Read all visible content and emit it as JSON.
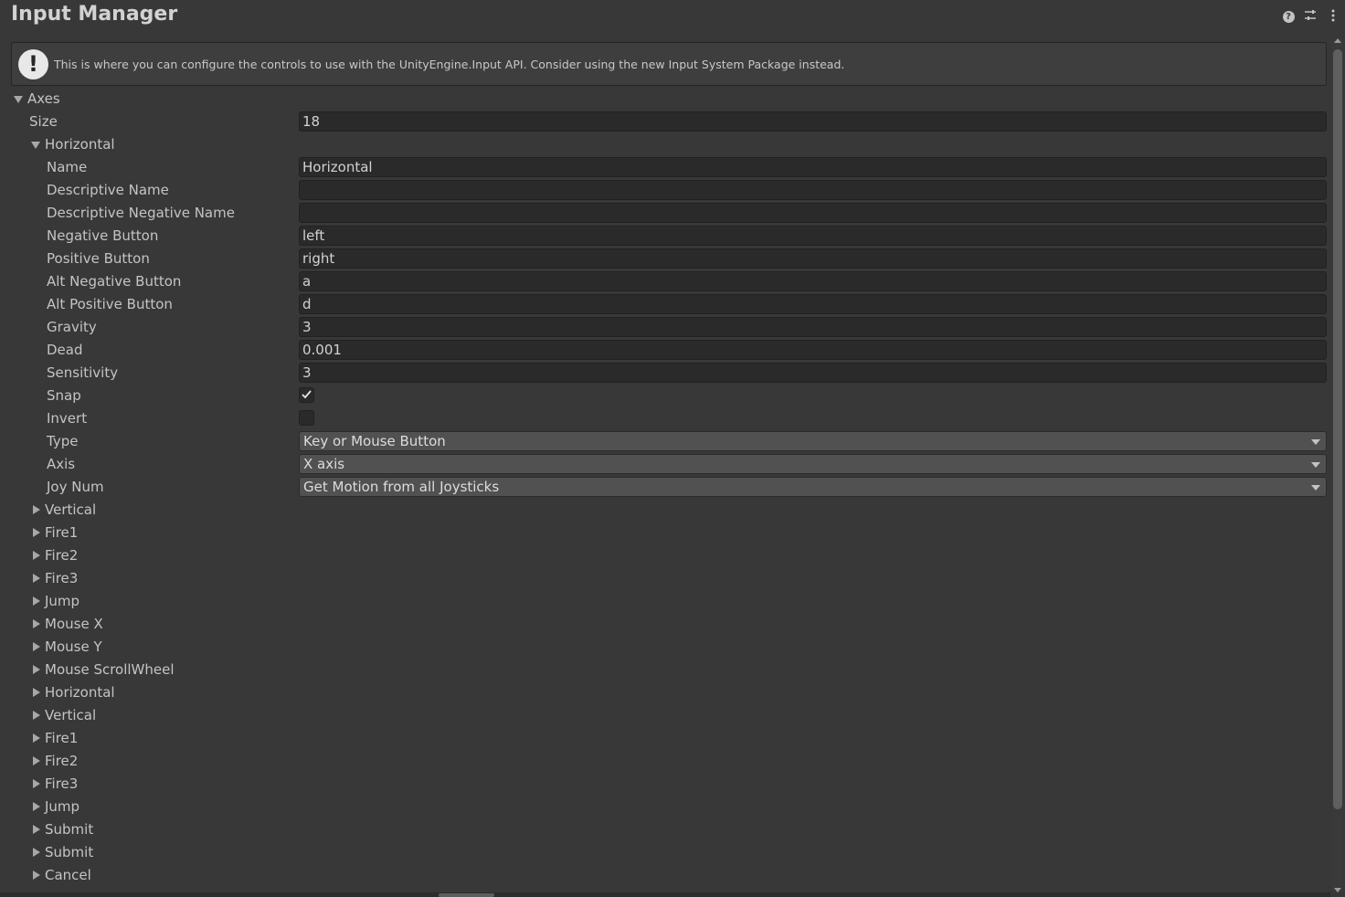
{
  "window": {
    "title": "Input Manager"
  },
  "header_icons": {
    "help": "help-icon",
    "presets": "presets-icon",
    "menu": "kebab-menu-icon"
  },
  "info": {
    "icon": "warning-icon",
    "text": "This is where you can configure the controls to use with the UnityEngine.Input API. Consider using the new Input System Package instead."
  },
  "axes": {
    "label": "Axes",
    "size_label": "Size",
    "size_value": "18",
    "expanded_axis": {
      "label": "Horizontal",
      "name_label": "Name",
      "name_value": "Horizontal",
      "descriptive_name_label": "Descriptive Name",
      "descriptive_name_value": "",
      "descriptive_negative_name_label": "Descriptive Negative Name",
      "descriptive_negative_name_value": "",
      "negative_button_label": "Negative Button",
      "negative_button_value": "left",
      "positive_button_label": "Positive Button",
      "positive_button_value": "right",
      "alt_negative_button_label": "Alt Negative Button",
      "alt_negative_button_value": "a",
      "alt_positive_button_label": "Alt Positive Button",
      "alt_positive_button_value": "d",
      "gravity_label": "Gravity",
      "gravity_value": "3",
      "dead_label": "Dead",
      "dead_value": "0.001",
      "sensitivity_label": "Sensitivity",
      "sensitivity_value": "3",
      "snap_label": "Snap",
      "snap_checked": true,
      "invert_label": "Invert",
      "invert_checked": false,
      "type_label": "Type",
      "type_value": "Key or Mouse Button",
      "axis_label": "Axis",
      "axis_value": "X axis",
      "joy_num_label": "Joy Num",
      "joy_num_value": "Get Motion from all Joysticks"
    },
    "collapsed_axes": [
      "Vertical",
      "Fire1",
      "Fire2",
      "Fire3",
      "Jump",
      "Mouse X",
      "Mouse Y",
      "Mouse ScrollWheel",
      "Horizontal",
      "Vertical",
      "Fire1",
      "Fire2",
      "Fire3",
      "Jump",
      "Submit",
      "Submit",
      "Cancel"
    ]
  }
}
